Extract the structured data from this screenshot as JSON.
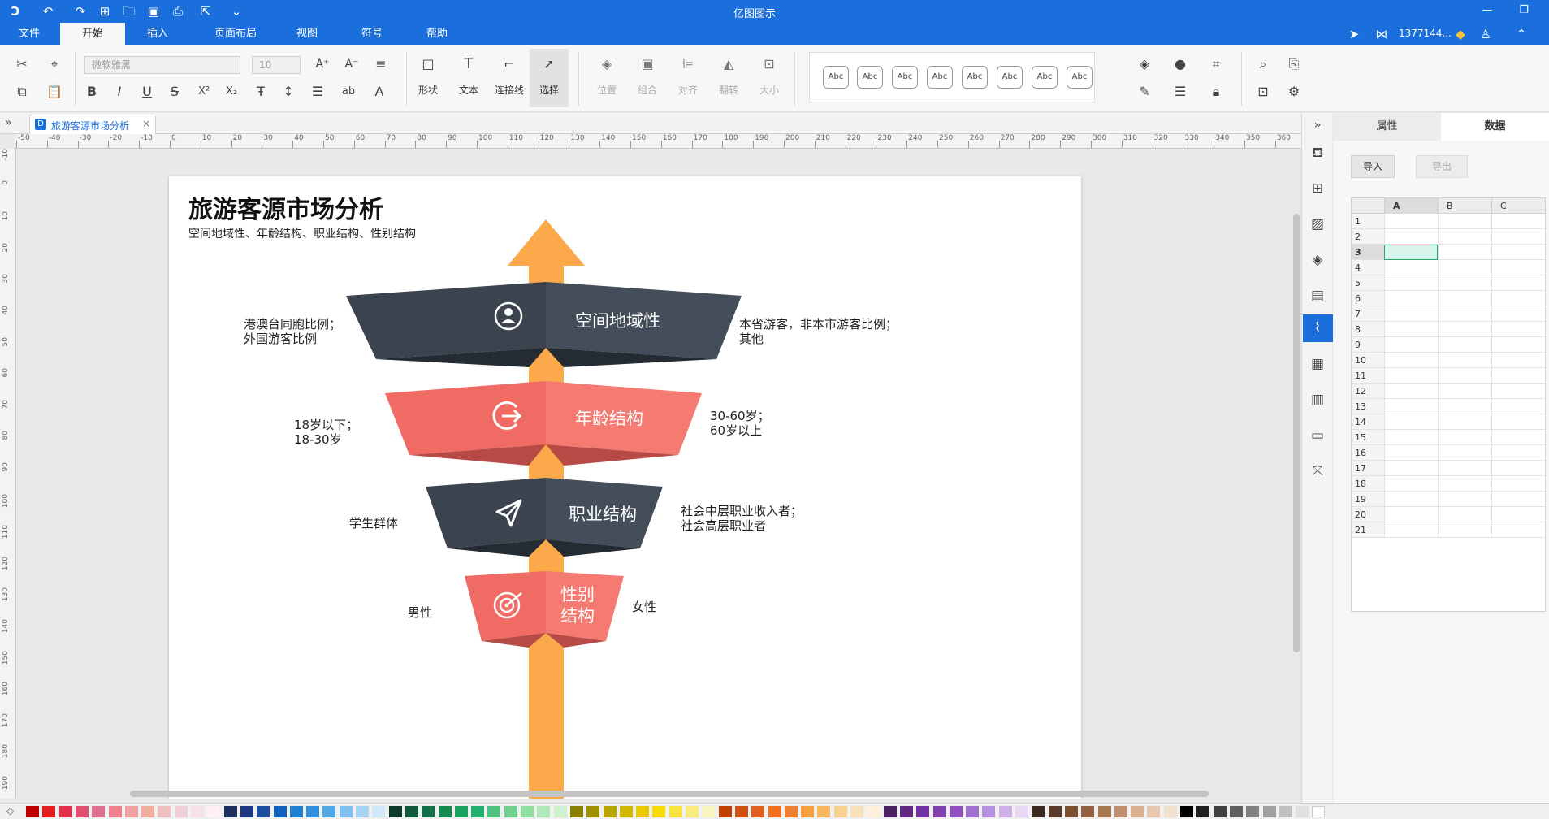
{
  "app": {
    "title": "亿图图示",
    "user": "1377144..."
  },
  "menu": {
    "items": [
      "文件",
      "开始",
      "插入",
      "页面布局",
      "视图",
      "符号",
      "帮助"
    ],
    "active": "开始"
  },
  "ribbon": {
    "font_name": "微软雅黑",
    "font_size": "10",
    "tools": {
      "shape": "形状",
      "text": "文本",
      "connector": "连接线",
      "select": "选择",
      "position": "位置",
      "group": "组合",
      "align": "对齐",
      "flip": "翻转",
      "size": "大小"
    },
    "style_sample": "Abc"
  },
  "doc_tab": {
    "label": "旅游客源市场分析"
  },
  "ruler": {
    "h_ticks": [
      "-50",
      "-40",
      "-30",
      "-20",
      "-10",
      "0",
      "10",
      "20",
      "30",
      "40",
      "50",
      "60",
      "70",
      "80",
      "90",
      "100",
      "110",
      "120",
      "130",
      "140",
      "150",
      "160",
      "170",
      "180",
      "190",
      "200",
      "210",
      "220",
      "230",
      "240",
      "250",
      "260",
      "270",
      "280",
      "290",
      "300",
      "310",
      "320",
      "330",
      "340",
      "350",
      "360"
    ],
    "v_ticks": [
      "-10",
      "0",
      "10",
      "20",
      "30",
      "40",
      "50",
      "60",
      "70",
      "80",
      "90",
      "100",
      "110",
      "120",
      "130",
      "140",
      "150",
      "160",
      "170",
      "180",
      "190"
    ]
  },
  "diagram": {
    "title": "旅游客源市场分析",
    "subtitle": "空间地域性、年龄结构、职业结构、性别结构",
    "tiers": [
      {
        "label": "空间地域性",
        "icon": "user-icon",
        "left_text": "港澳台同胞比例；\n外国游客比例",
        "right_text": "本省游客，非本市游客比例；\n其他"
      },
      {
        "label": "年龄结构",
        "icon": "exit-icon",
        "left_text": "18岁以下；\n18-30岁",
        "right_text": "30-60岁；\n60岁以上"
      },
      {
        "label": "职业结构",
        "icon": "paper-plane-icon",
        "left_text": "学生群体",
        "right_text": "社会中层职业收入者；\n社会高层职业者"
      },
      {
        "label": "性别\n结构",
        "icon": "target-icon",
        "left_text": "男性",
        "right_text": "女性"
      }
    ],
    "colors": {
      "dark": "#3a434e",
      "dark_shadow": "#242b33",
      "red": "#f06b63",
      "red_shadow": "#b84a45",
      "arrow": "#fba94a"
    }
  },
  "panel": {
    "tabs": [
      "属性",
      "数据"
    ],
    "active_tab": "数据",
    "import_label": "导入",
    "export_label": "导出",
    "columns": [
      "A",
      "B",
      "C"
    ],
    "rows": [
      "1",
      "2",
      "3",
      "4",
      "5",
      "6",
      "7",
      "8",
      "9",
      "10",
      "11",
      "12",
      "13",
      "14",
      "15",
      "16",
      "17",
      "18",
      "19",
      "20",
      "21"
    ],
    "selected_row": "3"
  },
  "palette": {
    "colors": [
      "#c00000",
      "#e02020",
      "#e0304a",
      "#e05070",
      "#e07090",
      "#f08090",
      "#f0a0a0",
      "#f0b0a0",
      "#f0c0c0",
      "#f0d0d8",
      "#f8e0e8",
      "#fff0f4",
      "#1f2f5f",
      "#203880",
      "#1f4ea0",
      "#1060c0",
      "#2080d0",
      "#3090e0",
      "#50a8e8",
      "#80c0f0",
      "#a8d4f4",
      "#d0e8f8",
      "#0c3a2a",
      "#0f5a3a",
      "#127048",
      "#148a50",
      "#1aa060",
      "#20b070",
      "#50c080",
      "#70d090",
      "#90e0a0",
      "#b0e8b8",
      "#d0f0d0",
      "#8a8000",
      "#a09000",
      "#b8a400",
      "#d0b800",
      "#e8cc00",
      "#f8dc00",
      "#f8e440",
      "#f8ec80",
      "#f8f4c0",
      "#c04000",
      "#d05010",
      "#e06020",
      "#f07020",
      "#f08030",
      "#f8a040",
      "#f8b860",
      "#f8d090",
      "#f8e0b8",
      "#fff0dc",
      "#4a2060",
      "#602880",
      "#7030a0",
      "#8040b0",
      "#9050c0",
      "#a070d0",
      "#b890e0",
      "#d0b0e8",
      "#e8d8f4",
      "#3a2a20",
      "#5a3a28",
      "#7a5030",
      "#906040",
      "#a87850",
      "#c09070",
      "#d8b090",
      "#e8c8b0",
      "#f0e0d0",
      "#000000",
      "#202020",
      "#404040",
      "#606060",
      "#808080",
      "#a0a0a0",
      "#c0c0c0",
      "#e0e0e0",
      "#ffffff"
    ]
  }
}
